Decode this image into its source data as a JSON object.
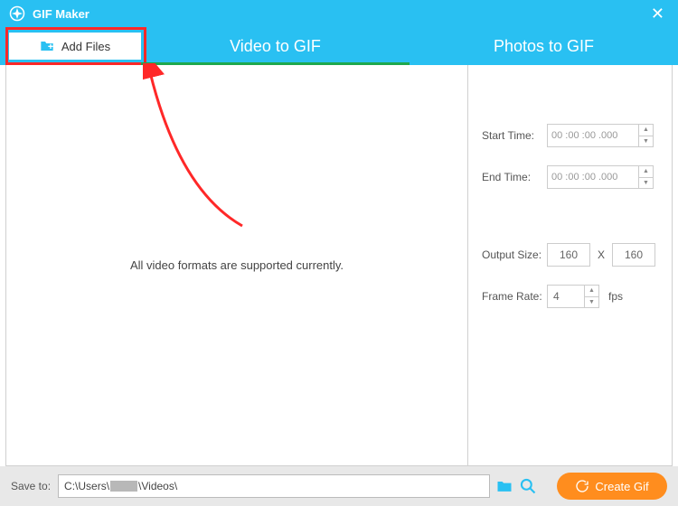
{
  "titlebar": {
    "title": "GIF Maker"
  },
  "toolbar": {
    "add_files_label": "Add Files"
  },
  "tabs": {
    "video": "Video to GIF",
    "photos": "Photos to GIF"
  },
  "preview": {
    "message": "All video formats are supported currently."
  },
  "settings": {
    "start_time_label": "Start Time:",
    "start_time_value": "00 :00 :00 .000",
    "end_time_label": "End Time:",
    "end_time_value": "00 :00 :00 .000",
    "output_size_label": "Output Size:",
    "width": "160",
    "height": "160",
    "size_sep": "X",
    "frame_rate_label": "Frame Rate:",
    "frame_rate_value": "4",
    "fps_unit": "fps"
  },
  "footer": {
    "save_to_label": "Save to:",
    "path_prefix": "C:\\Users\\",
    "path_suffix": "\\Videos\\",
    "create_label": "Create Gif"
  }
}
